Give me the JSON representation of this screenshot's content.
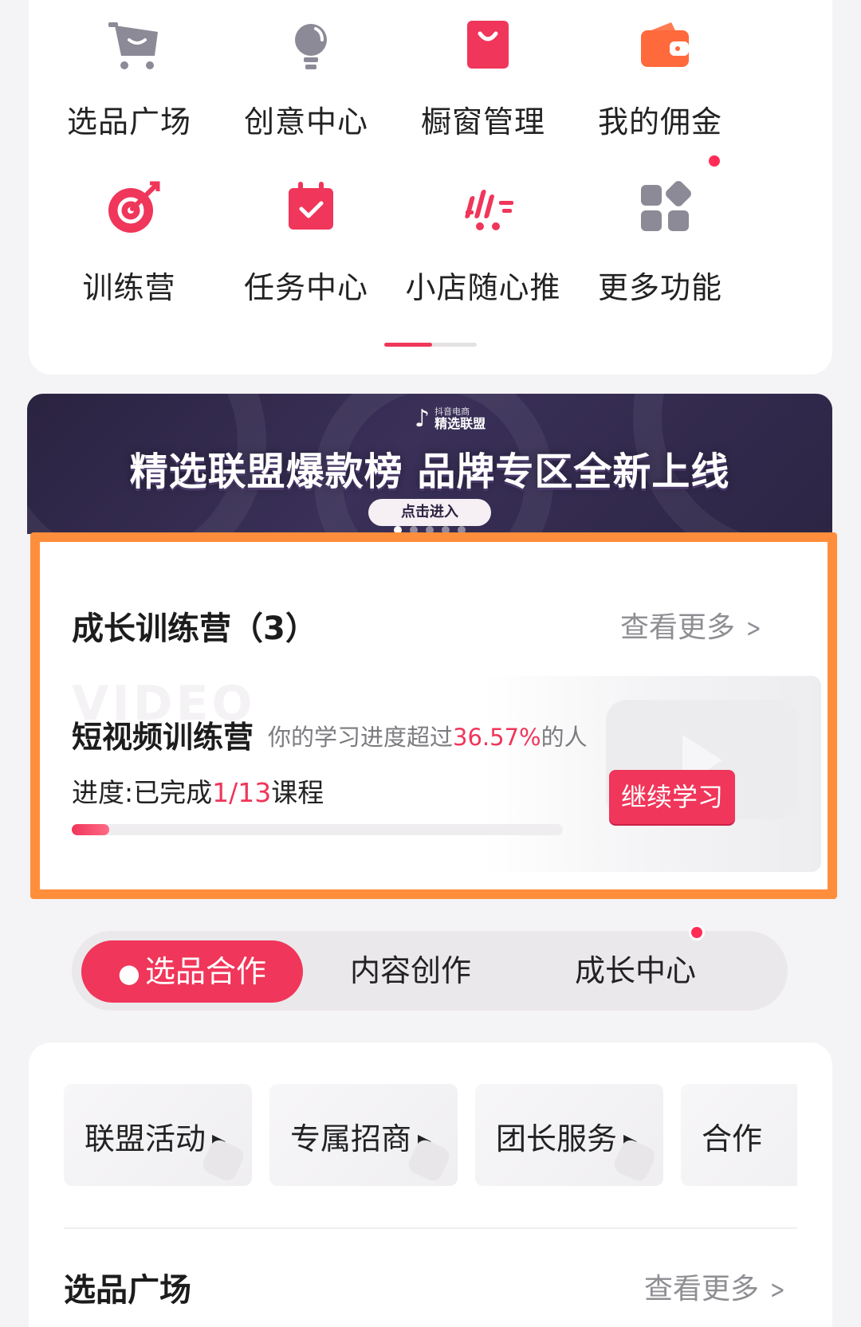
{
  "grid": {
    "items": [
      {
        "label": "选品广场",
        "icon": "cart-icon"
      },
      {
        "label": "创意中心",
        "icon": "lightbulb-icon"
      },
      {
        "label": "橱窗管理",
        "icon": "shopping-bag-icon"
      },
      {
        "label": "我的佣金",
        "icon": "wallet-icon"
      },
      {
        "label": "训练营",
        "icon": "target-icon"
      },
      {
        "label": "任务中心",
        "icon": "calendar-check-icon"
      },
      {
        "label": "小店随心推",
        "icon": "speed-cart-icon"
      },
      {
        "label": "更多功能",
        "icon": "apps-grid-icon"
      }
    ]
  },
  "banner": {
    "logo_top": "抖音电商",
    "logo_bottom": "精选联盟",
    "headline": "精选联盟爆款榜 品牌专区全新上线",
    "button": "点击进入"
  },
  "camp": {
    "title": "成长训练营（3）",
    "see_more": "查看更多",
    "course": {
      "watermark": "VIDEO",
      "name": "短视频训练营",
      "sub_prefix": "你的学习进度超过",
      "sub_value": "36.57%",
      "sub_suffix": "的人",
      "progress_prefix": "进度:已完成",
      "progress_value": "1/13",
      "progress_suffix": "课程",
      "progress_fraction": 0.0769,
      "button": "继续学习"
    }
  },
  "tabs": [
    {
      "label": "选品合作",
      "active": true
    },
    {
      "label": "内容创作",
      "active": false
    },
    {
      "label": "成长中心",
      "active": false,
      "badge": true
    }
  ],
  "chips": [
    {
      "label": "联盟活动"
    },
    {
      "label": "专属招商"
    },
    {
      "label": "团长服务"
    },
    {
      "label": "合作"
    }
  ],
  "market": {
    "title": "选品广场",
    "see_more": "查看更多"
  },
  "colors": {
    "accent": "#f0365a",
    "highlight_border": "#ff8e3c",
    "badge": "#ff2d55"
  }
}
